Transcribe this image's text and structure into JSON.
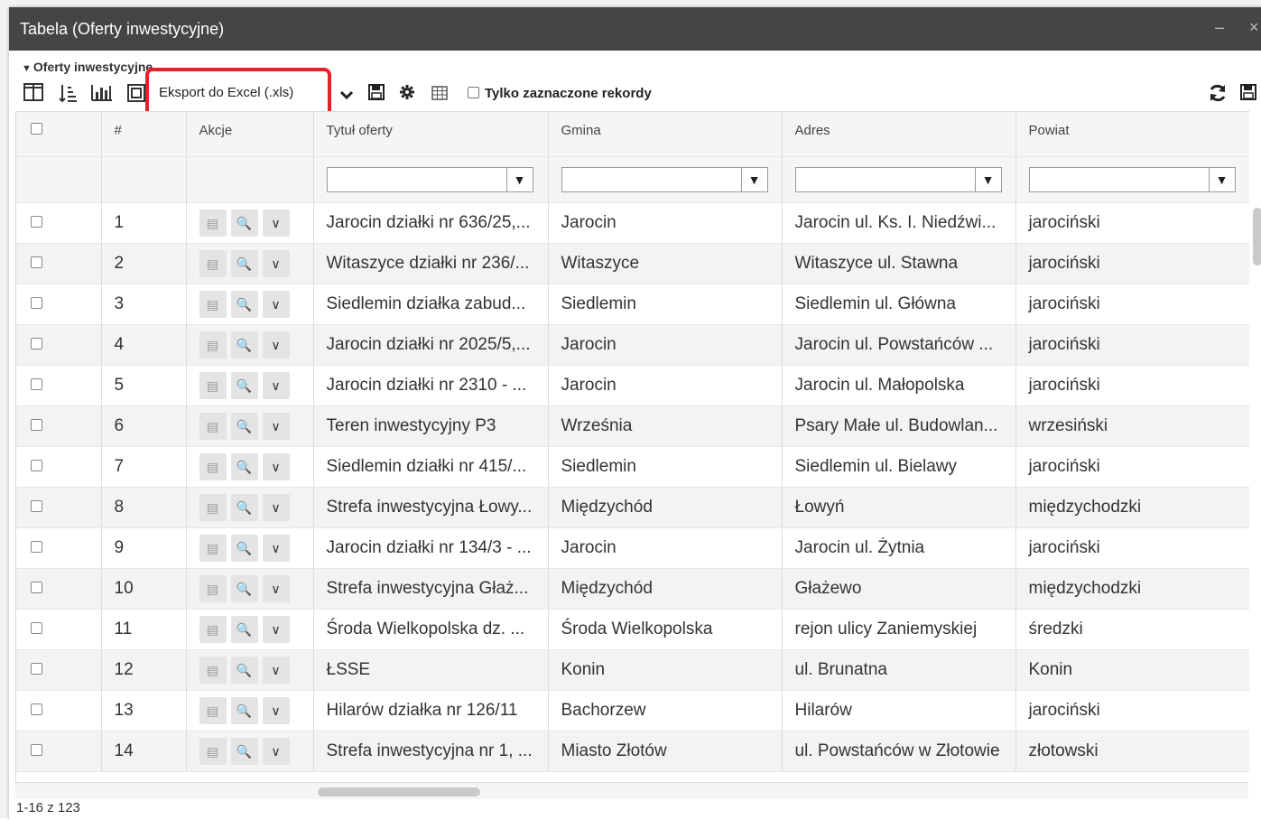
{
  "window": {
    "title": "Tabela (Oferty inwestycyjne)",
    "minimize": "–",
    "close": "×"
  },
  "section": {
    "label": "Oferty inwestycyjne"
  },
  "toolbar": {
    "export_label": "Eksport do Excel (.xls)",
    "only_selected_label": "Tylko zaznaczone rekordy",
    "icons": [
      "columns-icon",
      "sort-icon",
      "chart-icon",
      "layout-icon",
      "chevron-down-icon",
      "save-icon",
      "gear-icon",
      "grid-icon",
      "refresh-icon",
      "save-icon"
    ],
    "highlight_color": "#e8202a"
  },
  "table": {
    "columns": [
      "#",
      "Akcje",
      "Tytuł oferty",
      "Gmina",
      "Adres",
      "Powiat"
    ],
    "rows": [
      {
        "num": "1",
        "title": "Jarocin działki nr 636/25,...",
        "gmina": "Jarocin",
        "adres": "Jarocin ul. Ks. I. Niedźwi...",
        "powiat": "jarociński"
      },
      {
        "num": "2",
        "title": "Witaszyce działki nr 236/...",
        "gmina": "Witaszyce",
        "adres": "Witaszyce ul. Stawna",
        "powiat": "jarociński"
      },
      {
        "num": "3",
        "title": "Siedlemin działka zabud...",
        "gmina": "Siedlemin",
        "adres": "Siedlemin ul. Główna",
        "powiat": "jarociński"
      },
      {
        "num": "4",
        "title": "Jarocin działki nr 2025/5,...",
        "gmina": "Jarocin",
        "adres": "Jarocin ul. Powstańców ...",
        "powiat": "jarociński"
      },
      {
        "num": "5",
        "title": "Jarocin działki nr 2310 - ...",
        "gmina": "Jarocin",
        "adres": "Jarocin ul. Małopolska",
        "powiat": "jarociński"
      },
      {
        "num": "6",
        "title": "Teren inwestycyjny P3",
        "gmina": "Września",
        "adres": "Psary Małe ul. Budowlan...",
        "powiat": "wrzesiński"
      },
      {
        "num": "7",
        "title": "Siedlemin działki nr 415/...",
        "gmina": "Siedlemin",
        "adres": "Siedlemin ul. Bielawy",
        "powiat": "jarociński"
      },
      {
        "num": "8",
        "title": "Strefa inwestycyjna Łowy...",
        "gmina": "Międzychód",
        "adres": "Łowyń",
        "powiat": "międzychodzki"
      },
      {
        "num": "9",
        "title": "Jarocin działki nr 134/3 - ...",
        "gmina": "Jarocin",
        "adres": "Jarocin ul. Żytnia",
        "powiat": "jarociński"
      },
      {
        "num": "10",
        "title": "Strefa inwestycyjna Głaż...",
        "gmina": "Międzychód",
        "adres": "Głażewo",
        "powiat": "międzychodzki"
      },
      {
        "num": "11",
        "title": "Środa Wielkopolska dz. ...",
        "gmina": "Środa Wielkopolska",
        "adres": "rejon ulicy Zaniemyskiej",
        "powiat": "średzki"
      },
      {
        "num": "12",
        "title": "ŁSSE",
        "gmina": "Konin",
        "adres": "ul. Brunatna",
        "powiat": "Konin"
      },
      {
        "num": "13",
        "title": "Hilarów działka nr 126/11",
        "gmina": "Bachorzew",
        "adres": "Hilarów",
        "powiat": "jarociński"
      },
      {
        "num": "14",
        "title": "Strefa inwestycyjna nr 1, ...",
        "gmina": "Miasto Złotów",
        "adres": "ul. Powstańców w Złotowie",
        "powiat": "złotowski"
      }
    ]
  },
  "pager": {
    "text": "1-16 z 123"
  }
}
